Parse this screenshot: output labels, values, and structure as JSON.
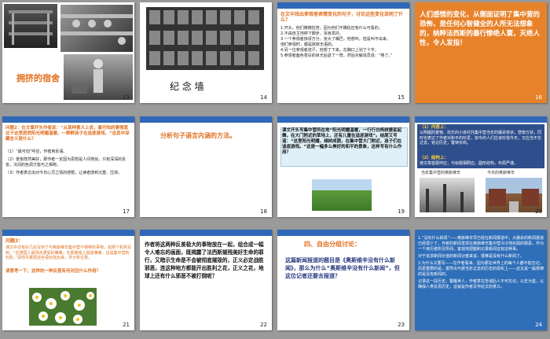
{
  "slides": [
    {
      "num": "13",
      "title": "拥挤的宿舍"
    },
    {
      "num": "14",
      "title": "纪  念  墙"
    },
    {
      "num": "15",
      "heading": "在文中找出参观者表情变化的句子，讨论这些变化说明了什么？",
      "lines": [
        "1.开头，他们微微挖苦，因为他们不确信还有什么可看的。",
        "2.不由自主地停下脚步，浑身发抖。",
        "3.一个参观者惊讶万分，张大了嘴巴，他想叫，但是叫不出来。",
        "他们参观时，都是默默无语的。",
        "4.另一位参观者流汗，他想了下来，在胸口上划了十字。",
        "5.参观者面色苍白的目光后退了一阵，然后对解说员说：“够了。”"
      ]
    },
    {
      "num": "16",
      "text": "人们感情的变化，从侧面证明了集中营的恐怖，是任何心智健全的人所无法想象的，纳粹法西斯的暴行惨绝人寰，灭绝人性，令人发指！"
    },
    {
      "num": "17",
      "heading": "问题2：在文章开头作者说：“从某种意义上说，最可怕的事情莫过于这里居然阳光明媚温暖，一群群孩子在追逐游戏。”这其中深藏含义是什么？",
      "lines": [
        "（1）“最可怕”呼应，作者用反语。",
        "（2）景象既然美好，那作者一定因为思想是人间地狱，只有深深的反省，沉闷的色调才能与之相称。",
        "（3）作者表达出对今日心灵之情的感慨，让读者感到沉重、压抑。"
      ]
    },
    {
      "num": "18",
      "text": "分析句子语言内涵的方法。"
    },
    {
      "num": "19",
      "text": "课文开头写集中营所在地“阳光明媚温暖，一行行白杨树婆娑起舞，在大门附近的草地上，还有儿童在追逐游戏”。结尾又写道：“这里阳光明媚，绿树成荫，在集中营大门附近，孩子们在追逐游戏。”这是一幅多么美好的和平的景象，这样写有什么作用？"
    },
    {
      "num": "20",
      "p1label": "（1）内容上：",
      "p1": "以明媚的景物、欢乐的小孩衬托集中营当年的屠杀惨状，悲惨万状，同时也表达了作者对和平的珍爱，如今的人们应该珍惜今天，又应当不忘过去，铭记历史，警钟长鸣。",
      "p2label": "（2）结构上：",
      "p2": "使文章首尾呼应，与标题相照应，圆形结构，布局严谨。",
      "cap1": "当年集中营的奥斯维辛",
      "cap2": "今天的奥斯维辛"
    },
    {
      "num": "21",
      "heading": "问题3：",
      "text": "课文中还有好几处写到了与奥斯维辛集中营不相称的事物，如那个机构写到，“在德国人最残杀遭受的雏菊，在那废墟上挺拔雏菊，这是集中营的石阶。”请你尽量把这些语句找出来，并分析在意。",
      "question": "请思考一下，这样的一种反差有何对应什么作用？"
    },
    {
      "num": "22",
      "text": "作者将这两种反差极大的事物放在一起，组合成一幅令人难忘的画面，既揭露了法西斯摧残美好生命的罪行，又暗示生命是不会被彻底摧毁的，正义必定战胜邪恶，连这种地方都能开出胜利之花，正义之花，地球上还有什么邪恶不被打倒呢？"
    },
    {
      "num": "23",
      "heading": "四、自由分组讨论：",
      "text": "这篇新闻报道的题目是《奥斯维辛没有什么新闻》，那么为什么“奥斯维辛没有什么新闻”，但这位记者还要去报道？"
    },
    {
      "num": "24",
      "lines": [
        "1.“没有什么新闻”——奥斯维辛早已经在新闻报道中，大屠杀的新闻报道已经很少了。作者的新闻发现在奥斯维辛集中营冷冷地实践的罪恶，作为一个亲历者所见所闻，客观地把握和记录新闻这有这种事。",
        "对于追求新闻价值的新闻记者来说，很难是没有什么新闻了。",
        "2.为什么又要写——在作者看来，因为那在世界上的每个人都不能忘记，而更重要的是，报导出与那当年过去的历史的现实上——这又是一般规律的是没有新闻的。",
        "记录这一段历史，警醒世人，作者意在告诫后人不可忘记，以史为鉴，以确保人类反思历史，这就是作者写作此文的意义。"
      ]
    }
  ]
}
